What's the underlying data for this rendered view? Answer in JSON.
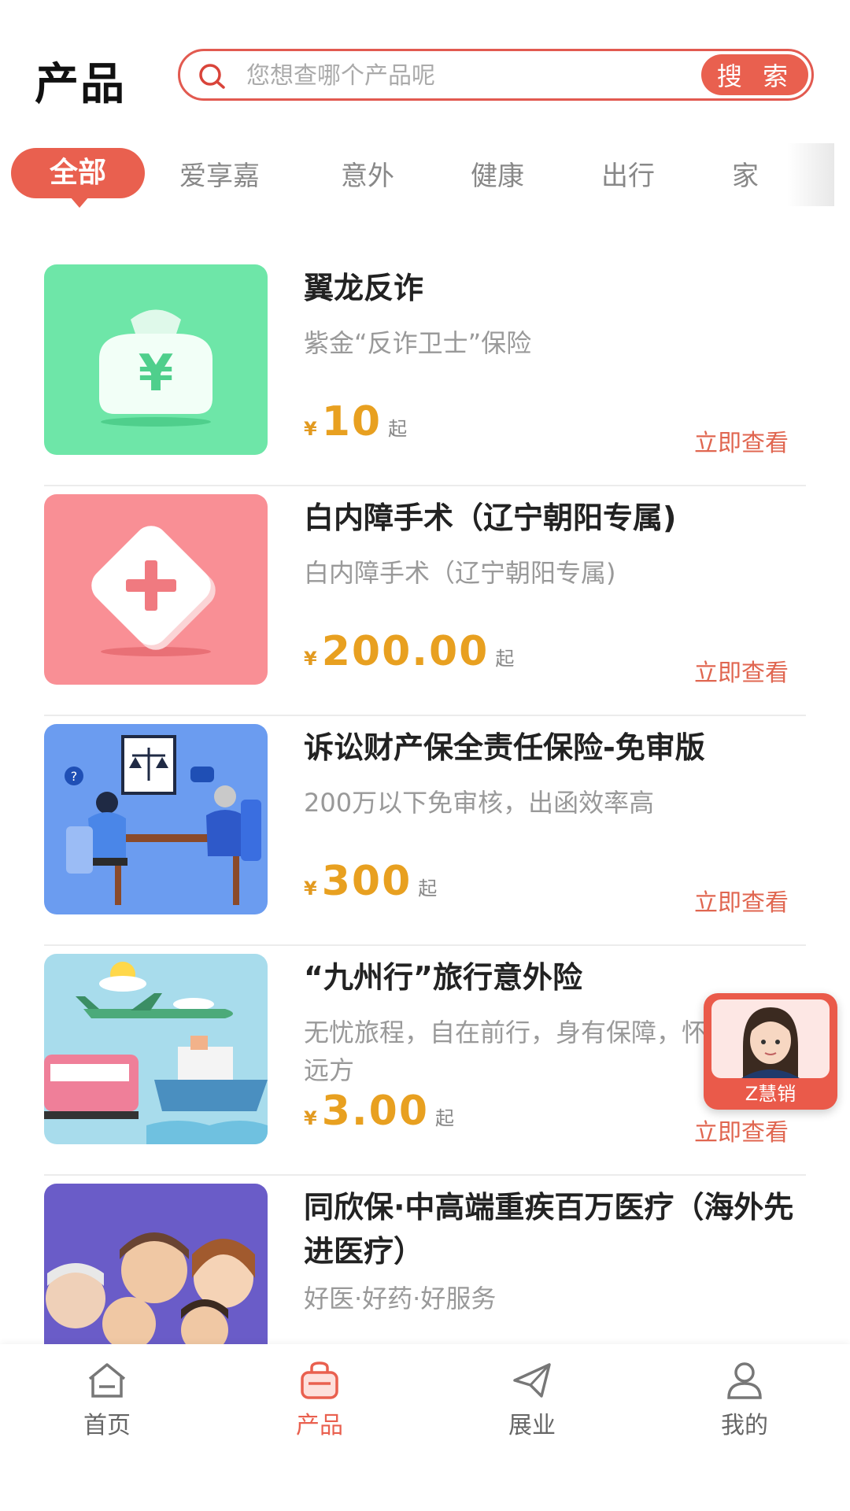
{
  "header": {
    "title": "产品",
    "search": {
      "placeholder": "您想查哪个产品呢",
      "button_label": "搜 索"
    }
  },
  "tabs": [
    {
      "label": "全部",
      "active": true
    },
    {
      "label": "爱享嘉"
    },
    {
      "label": "意外"
    },
    {
      "label": "健康"
    },
    {
      "label": "出行"
    },
    {
      "label": "家"
    }
  ],
  "products": [
    {
      "name": "翼龙反诈",
      "desc": "紫金“反诈卫士”保险",
      "currency": "¥",
      "price": "10",
      "suffix": "起",
      "link": "立即查看",
      "thumb_color": "#6ee6a8",
      "icon": "money-bag-icon"
    },
    {
      "name": "白内障手术（辽宁朝阳专属)",
      "desc": "白内障手术（辽宁朝阳专属)",
      "currency": "¥",
      "price": "200.00",
      "suffix": "起",
      "link": "立即查看",
      "thumb_color": "#f98f95",
      "icon": "medical-cross-icon"
    },
    {
      "name": "诉讼财产保全责任保险-免审版",
      "desc": "200万以下免审核，出函效率高",
      "currency": "¥",
      "price": "300",
      "suffix": "起",
      "link": "立即查看",
      "thumb_color": "#6b9cf0",
      "icon": "legal-consultation-illustration"
    },
    {
      "name": "“九州行”旅行意外险",
      "desc": "无忧旅程，自在前行，身有保障，怀远方",
      "currency": "¥",
      "price": "3.00",
      "suffix": "起",
      "link": "立即查看",
      "thumb_color": "#a8dcec",
      "icon": "travel-transport-illustration"
    },
    {
      "name": "同欣保·中高端重疾百万医疗（海外先进医疗）",
      "desc": "好医·好药·好服务",
      "thumb_color": "#6a5cc8",
      "icon": "family-illustration"
    }
  ],
  "assistant": {
    "label": "Z慧销"
  },
  "bottom_nav": [
    {
      "label": "首页",
      "icon": "home-icon"
    },
    {
      "label": "产品",
      "icon": "bag-icon",
      "active": true
    },
    {
      "label": "展业",
      "icon": "paper-plane-icon"
    },
    {
      "label": "我的",
      "icon": "user-icon"
    }
  ],
  "colors": {
    "accent": "#e9604f",
    "price": "#e8a020",
    "link": "#e06650"
  }
}
